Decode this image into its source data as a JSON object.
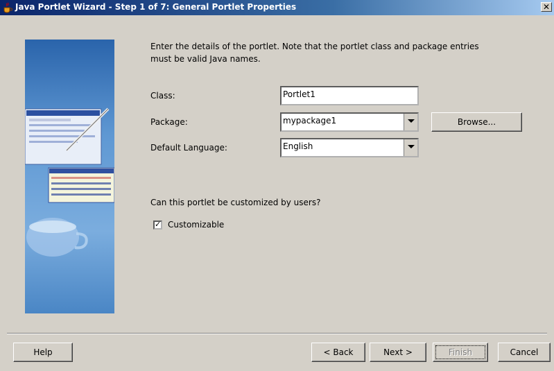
{
  "window": {
    "title": "Java Portlet Wizard - Step 1 of 7: General Portlet Properties",
    "close_icon": "close-icon"
  },
  "intro": {
    "line1": "Enter the details of the portlet. Note that the portlet class and package entries",
    "line2": "must be valid Java names."
  },
  "form": {
    "class_label": "Class:",
    "class_value": "Portlet1",
    "package_label": "Package:",
    "package_value": "mypackage1",
    "browse_label": "Browse...",
    "language_label": "Default Language:",
    "language_value": "English"
  },
  "customize": {
    "question": "Can this portlet be customized by users?",
    "checkbox_label": "Customizable",
    "checked": true
  },
  "footer": {
    "help": "Help",
    "back": "< Back",
    "next": "Next >",
    "finish": "Finish",
    "cancel": "Cancel"
  }
}
